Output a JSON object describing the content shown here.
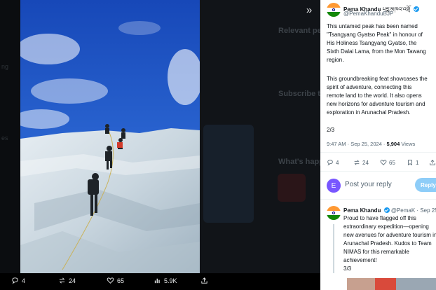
{
  "background": {
    "headings": [
      "Relevant people",
      "Subscribe to Premium",
      "What's happening"
    ],
    "left_fragments": [
      "ng",
      "es"
    ]
  },
  "photo": {
    "description_icon": "mountain-climbers-photo"
  },
  "actions": {
    "reply_count": "4",
    "repost_count": "24",
    "like_count": "65",
    "views_count": "5.9K"
  },
  "tweet": {
    "author_name": "Pema Khandu",
    "author_script": "པདྨ་མཁའ་འགྲོ",
    "author_handle": "@PemaKhanduBJP",
    "text_lines": [
      "This untamed peak has been named",
      "\"Tsangyang Gyatso Peak\" in honour of",
      "His Holiness Tsangyang Gyatso, the",
      "Sixth Dalai Lama, from the Mon Tawang",
      "region."
    ],
    "text_lines_2": [
      "This groundbreaking feat showcases the",
      "spirit of adventure, connecting this",
      "remote land to the world. It also opens",
      "new horizons for adventure tourism and",
      "exploration in Arunachal Pradesh."
    ],
    "counter": "2/3",
    "time": "9:47 AM",
    "date": "Sep 25, 2024",
    "views": "5,904",
    "views_label": "Views",
    "stats": {
      "replies": "4",
      "reposts": "24",
      "likes": "65",
      "bookmarks": "1"
    }
  },
  "reply_box": {
    "avatar_letter": "E",
    "placeholder": "Post your reply",
    "button": "Reply"
  },
  "reply_tweet": {
    "author_name": "Pema Khandu",
    "author_handle": "@PemaK",
    "date": "Sep 25",
    "text_lines": [
      "Proud to have flagged off this",
      "extraordinary expedition—opening",
      "new avenues for adventure tourism in",
      "Arunachal Pradesh. Kudos to Team",
      "NIMAS for this remarkable",
      "achievement!"
    ],
    "counter": "3/3"
  },
  "colors": {
    "sky": "#1f5fd6",
    "ice": "#d9e3ea",
    "accent": "#1d9bf0",
    "reply_button": "#8ecdf8"
  }
}
